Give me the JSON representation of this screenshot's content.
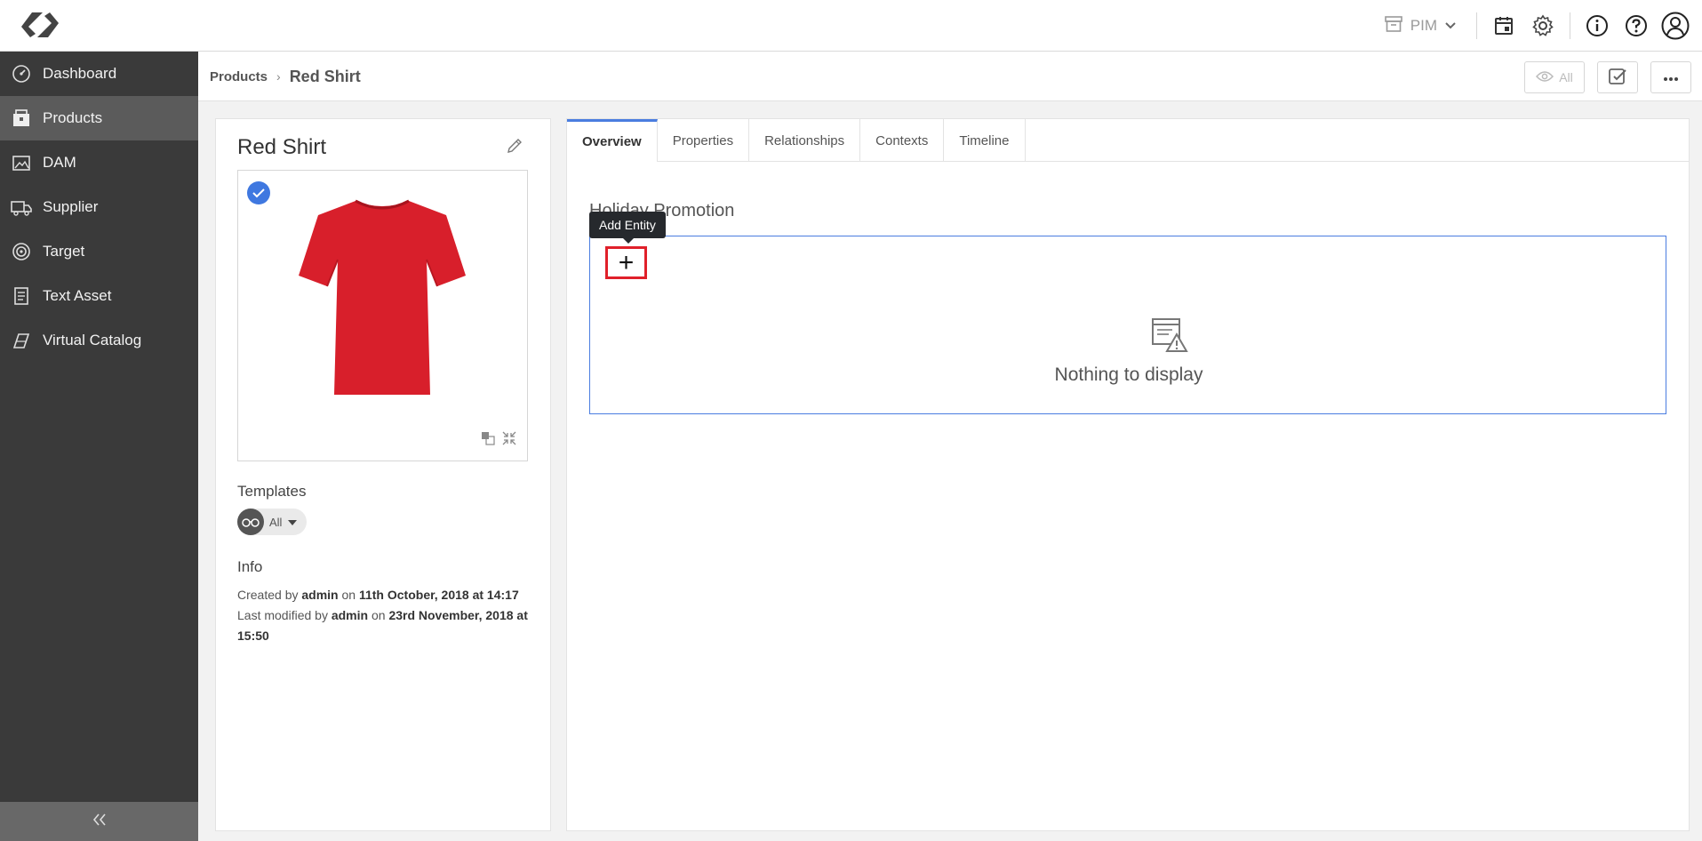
{
  "topbar": {
    "app_selector": "PIM",
    "icons": [
      "logo-icon",
      "archive-icon",
      "chevron-down-icon",
      "tasks-icon",
      "gear-icon",
      "info-icon",
      "help-icon",
      "user-icon"
    ]
  },
  "sidebar": {
    "items": [
      {
        "label": "Dashboard",
        "icon": "dashboard-icon"
      },
      {
        "label": "Products",
        "icon": "products-icon"
      },
      {
        "label": "DAM",
        "icon": "image-icon"
      },
      {
        "label": "Supplier",
        "icon": "truck-icon"
      },
      {
        "label": "Target",
        "icon": "target-icon"
      },
      {
        "label": "Text Asset",
        "icon": "document-icon"
      },
      {
        "label": "Virtual Catalog",
        "icon": "catalog-icon"
      }
    ],
    "active": "Products"
  },
  "breadcrumb": {
    "parent": "Products",
    "separator": "›",
    "current": "Red Shirt",
    "view_button_label": "All"
  },
  "entity": {
    "title": "Red Shirt",
    "templates_label": "Templates",
    "template_value": "All",
    "info_label": "Info",
    "created_prefix": "Created by",
    "created_by": "admin",
    "created_on_word": "on",
    "created_date": "11th October, 2018 at 14:17",
    "modified_prefix": "Last modified by",
    "modified_by": "admin",
    "modified_on_word": "on",
    "modified_date": "23rd November, 2018 at 15:50"
  },
  "tabs": [
    {
      "label": "Overview"
    },
    {
      "label": "Properties"
    },
    {
      "label": "Relationships"
    },
    {
      "label": "Contexts"
    },
    {
      "label": "Timeline"
    }
  ],
  "overview": {
    "section_title": "Holiday Promotion",
    "add_button": "+",
    "tooltip": "Add Entity",
    "empty_message": "Nothing to display"
  },
  "colors": {
    "sidebar_bg": "#3a3a3a",
    "sidebar_active": "#5b5b5b",
    "accent": "#4a7de0",
    "highlight": "#e0202a",
    "shirt": "#d81f2b"
  }
}
